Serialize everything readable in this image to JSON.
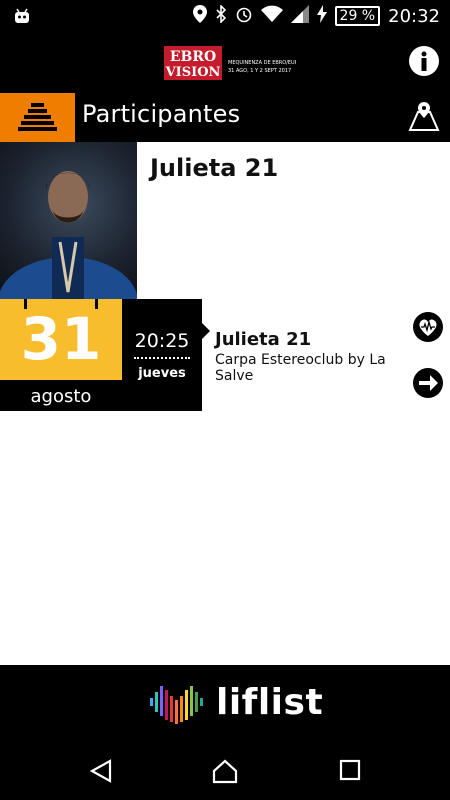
{
  "status_bar": {
    "battery_percent": "29 %",
    "time": "20:32"
  },
  "header": {
    "logo_line1": "EBRO",
    "logo_line2": "VISION",
    "logo_subtitle": "MEQUINENZA DE EBRO/EUROPA\n31 AGO, 1 Y 2 SEPT 2017",
    "icons": {
      "info": "info-icon",
      "map": "map-icon",
      "section": "stack-icon"
    }
  },
  "section": {
    "title": "Participantes"
  },
  "artist": {
    "name": "Julieta 21"
  },
  "event": {
    "day": "31",
    "month": "agosto",
    "time": "20:25",
    "weekday": "jueves",
    "title": "Julieta 21",
    "venue": "Carpa Estereoclub by La Salve"
  },
  "footer": {
    "brand": "liflist"
  },
  "colors": {
    "accent_orange": "#ef7e00",
    "accent_yellow": "#f7bd2d"
  }
}
